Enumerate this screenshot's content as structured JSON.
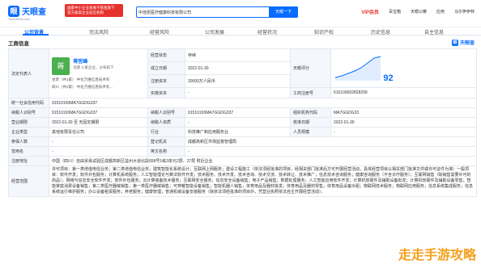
{
  "header": {
    "logo_text": "天眼查",
    "logo_sub": "TianYanCha.com",
    "badge_line1": "国家中小企业发展子基金旗下",
    "badge_line2": "官方备案企业征信机构",
    "search_value": "中佳愿医疗健康科技有限公司",
    "search_button": "天眼一下",
    "vip_label": "VIP会员",
    "nav_items": [
      "百宝箱",
      "天眼公察",
      "应用",
      "马尔伊伊林"
    ]
  },
  "tabs": [
    {
      "label": "公司背景",
      "count": "",
      "active": true
    },
    {
      "label": "司法风险",
      "count": "",
      "active": false
    },
    {
      "label": "经营风险",
      "count": "",
      "active": false
    },
    {
      "label": "公司发展",
      "count": "",
      "active": false
    },
    {
      "label": "经营状况",
      "count": "",
      "active": false
    },
    {
      "label": "知识产权",
      "count": "",
      "active": false
    },
    {
      "label": "历史信息",
      "count": "",
      "active": false
    },
    {
      "label": "自主信息",
      "count": "",
      "active": false
    }
  ],
  "section": {
    "title": "工商信息",
    "watermark": "天眼查"
  },
  "rep": {
    "label": "法定代表人",
    "avatar_char": "蒋",
    "name": "蒋哲峰",
    "sub": "任职 3 家企业，分布如下",
    "rel1": "甘肃（共1家）    中化万维信息技术有",
    "rel2": "四川（共2家）    中化万维信息技术有…"
  },
  "status": {
    "label": "经营状态",
    "value": "存续"
  },
  "founded": {
    "label": "成立日期",
    "value": "2022-01-30"
  },
  "capital": {
    "label": "注册资本",
    "value": "20000万人民币"
  },
  "paid": {
    "label": "实缴资本",
    "value": "-"
  },
  "score": {
    "label": "天眼评分",
    "value": "92"
  },
  "rows": [
    {
      "l1": "统一社会信用代码",
      "v1": "91510100MA7GGDG337",
      "l2": "工商注册号",
      "v2": "510109002828299"
    },
    {
      "l1": "纳税人识别号",
      "v1": "91510100MA7GGDG337",
      "l2": "纳税人识别号",
      "v2": "91510100MA7GGDG337",
      "l3": "组织机构代码",
      "v3": "MA7GGDG33"
    },
    {
      "l1": "营业期限",
      "v1": "2022-01-30 至 无固定期限",
      "l2": "纳税人资质",
      "v2": "-",
      "l3": "核准日期",
      "v3": "2022-01-30"
    },
    {
      "l1": "企业类型",
      "v1": "其他有限责任公司",
      "l2": "行业",
      "v2": "科技推广和应用服务业",
      "l3": "人员规模",
      "v3": "-"
    },
    {
      "l1": "参保人数",
      "v1": "-",
      "l2": "登记机关",
      "v2": "成都高新区市场监督管理局",
      "l3": "",
      "v3": ""
    },
    {
      "l1": "曾用名",
      "v1": "-",
      "l2": "英文名称",
      "v2": "-",
      "l3": "",
      "v3": ""
    },
    {
      "l1": "注册地址",
      "v1": "中国（四川）自由贸易试验区成都高新区益州大道北段558号1栋3单元2层、27层 附近企业",
      "l2": "",
      "v2": "",
      "l3": "",
      "v3": ""
    }
  ],
  "scope": {
    "label": "经营范围",
    "text": "许可项目：第一类增值电信业务；第二类增值电信业务；建筑智能化系统设计；互联网上网服务；建设工程施工（依法须经批准的项目，经相关部门批准后方可开展经营活动，具体经营项目以相关部门批准文件或许可证件为准）一般项目：软件开发；软件外包服务；计算机系统服务；人工智能理论与算法软件开发；技术服务、技术开发、技术咨询、技术交流、技术转让、技术推广；信息技术咨询服务；健康咨询服务（不含诊疗服务）；互联网销售（除销售需要许可的商品）；网络与信息安全软件开发；软件外包服务；云计算装备技术服务；互联网安全服务；信息安全设备销售；电子产品销售；数据处理服务；人工智能应用软件开发；计算机软硬件及辅助设备批发；计算机软硬件及辅助设备零售；智能家庭消费设备销售；第二类医疗器械销售；第一类医疗器械销售；可穿戴智能设备销售；智能机器人销售；体育用品及器材批发；体育用品及器材零售；体育用品设备出租；物联网技术服务；物联网应用服务；信息系统集成服务；信息系统运行维护服务；办公设备租赁服务；养老服务；健康管理；普通机械设备安装服务（除依法须经批准的项目外，凭营业执照依法自主开展经营活动）。"
  },
  "corner_watermark": "走走手游攻略"
}
